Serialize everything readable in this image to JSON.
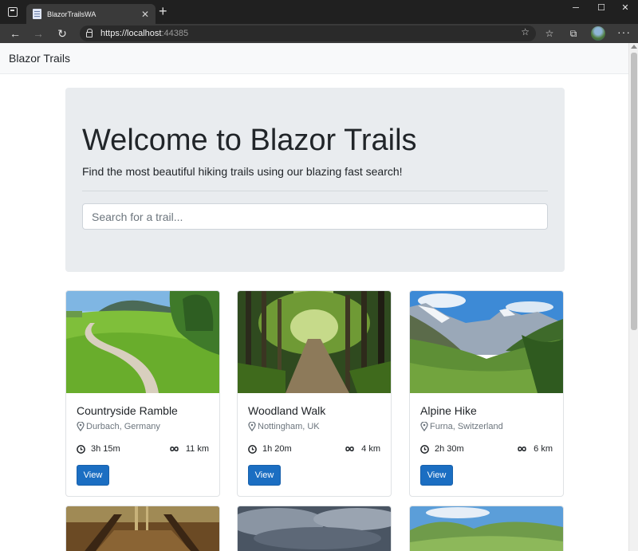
{
  "browser": {
    "tab_title": "BlazorTrailsWA",
    "url_host": "https://localhost",
    "url_port": ":44385"
  },
  "page": {
    "brand": "Blazor Trails",
    "hero": {
      "title": "Welcome to Blazor Trails",
      "subtitle": "Find the most beautiful hiking trails using our blazing fast search!",
      "search_placeholder": "Search for a trail..."
    },
    "trails": [
      {
        "name": "Countryside Ramble",
        "location": "Durbach, Germany",
        "time": "3h 15m",
        "length": "11 km",
        "button": "View"
      },
      {
        "name": "Woodland Walk",
        "location": "Nottingham, UK",
        "time": "1h 20m",
        "length": "4 km",
        "button": "View"
      },
      {
        "name": "Alpine Hike",
        "location": "Furna, Switzerland",
        "time": "2h 30m",
        "length": "6 km",
        "button": "View"
      }
    ]
  },
  "colors": {
    "primary_button": "#1b6ec2",
    "hero_background": "#e9ecef",
    "navbar_background": "#f8f9fa"
  },
  "icons": [
    "window-icon",
    "page-icon",
    "close-icon",
    "plus-icon",
    "back-icon",
    "forward-icon",
    "refresh-icon",
    "lock-icon",
    "star-icon",
    "favorites-icon",
    "collections-icon",
    "profile-avatar",
    "more-icon",
    "map-pin-icon",
    "clock-icon",
    "infinity-icon"
  ]
}
